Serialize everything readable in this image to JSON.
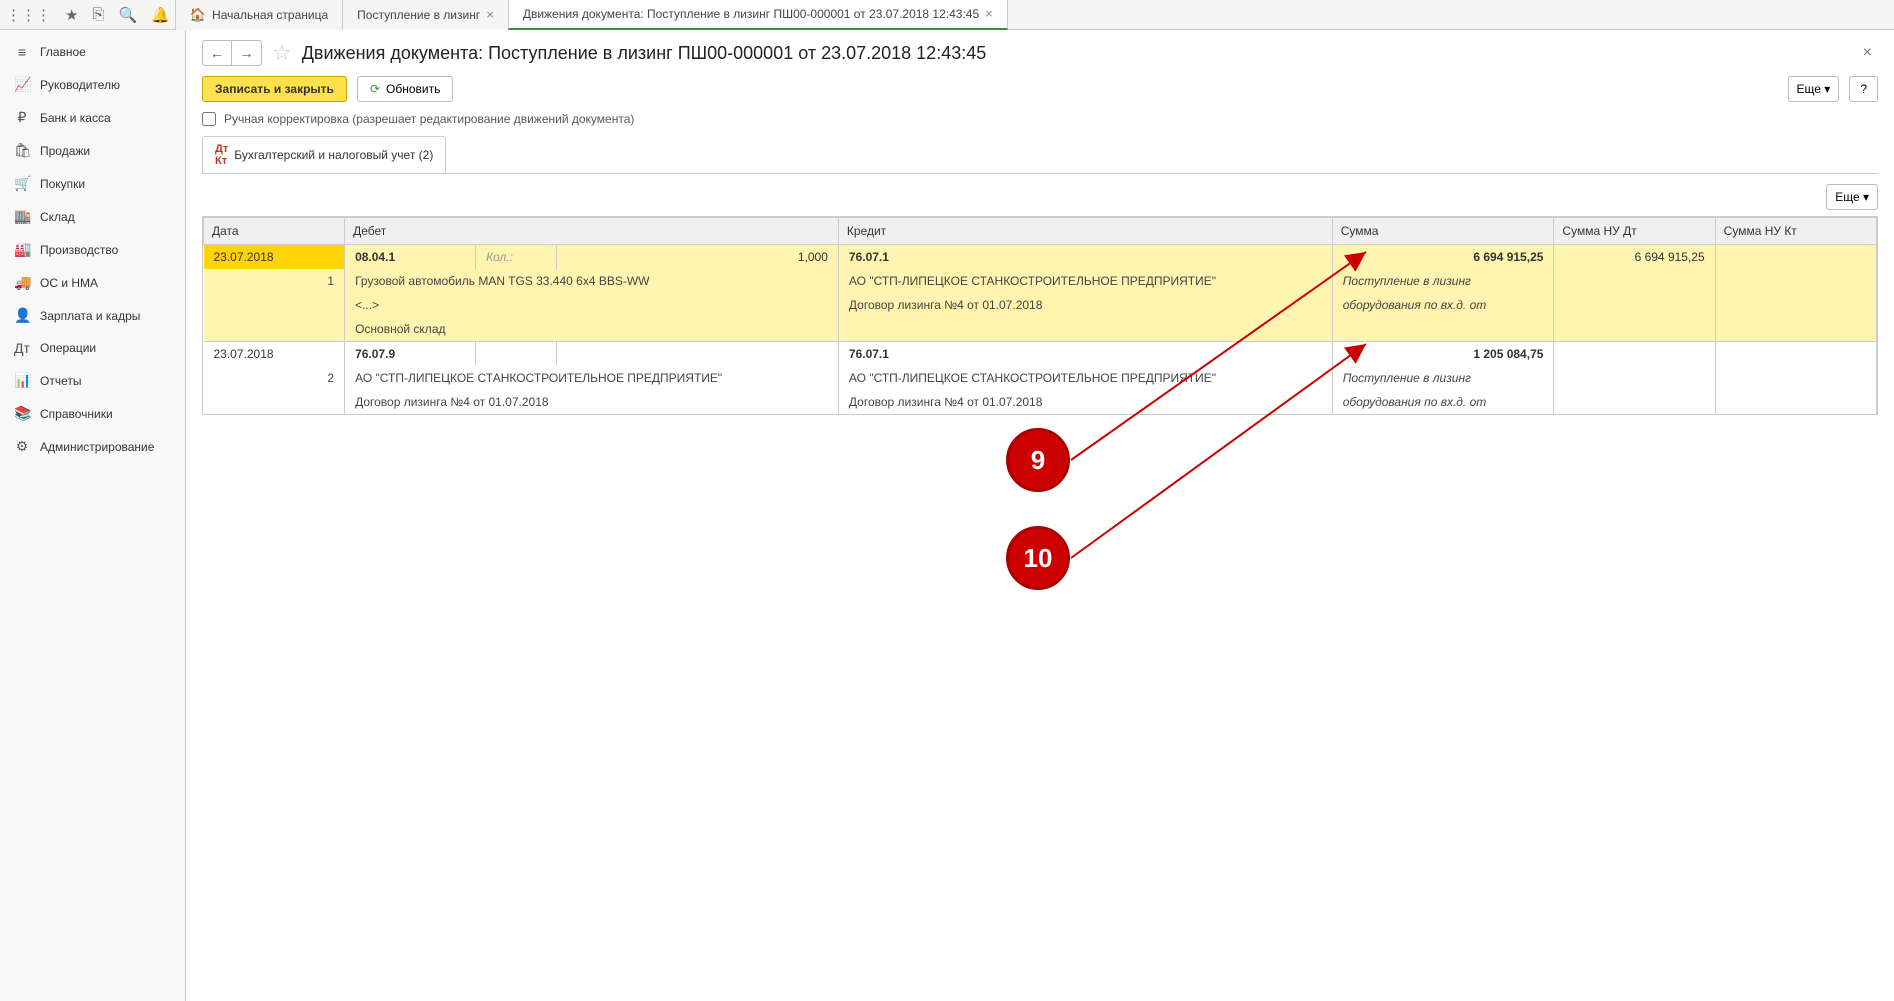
{
  "topTabs": {
    "home": "Начальная страница",
    "t1": "Поступление в лизинг",
    "t2": "Движения документа: Поступление в лизинг ПШ00-000001 от 23.07.2018 12:43:45"
  },
  "sidebar": [
    {
      "icon": "≡",
      "label": "Главное"
    },
    {
      "icon": "📈",
      "label": "Руководителю"
    },
    {
      "icon": "₽",
      "label": "Банк и касса"
    },
    {
      "icon": "🛍",
      "label": "Продажи"
    },
    {
      "icon": "🛒",
      "label": "Покупки"
    },
    {
      "icon": "🏬",
      "label": "Склад"
    },
    {
      "icon": "🏭",
      "label": "Производство"
    },
    {
      "icon": "🚚",
      "label": "ОС и НМА"
    },
    {
      "icon": "👤",
      "label": "Зарплата и кадры"
    },
    {
      "icon": "Дт",
      "label": "Операции"
    },
    {
      "icon": "📊",
      "label": "Отчеты"
    },
    {
      "icon": "📚",
      "label": "Справочники"
    },
    {
      "icon": "⚙",
      "label": "Администрирование"
    }
  ],
  "page": {
    "title": "Движения документа: Поступление в лизинг ПШ00-000001 от 23.07.2018 12:43:45",
    "saveClose": "Записать и закрыть",
    "refresh": "Обновить",
    "more": "Еще ▾",
    "help": "?",
    "manualLabel": "Ручная корректировка (разрешает редактирование движений документа)"
  },
  "innerTab": "Бухгалтерский и налоговый учет (2)",
  "cols": {
    "date": "Дата",
    "debit": "Дебет",
    "credit": "Кредит",
    "sum": "Сумма",
    "nudt": "Сумма НУ Дт",
    "nukt": "Сумма НУ Кт"
  },
  "rows": [
    {
      "n": "1",
      "date": "23.07.2018",
      "debAcc": "08.04.1",
      "kolLabel": "Кол.:",
      "kol": "1,000",
      "debL1": "Грузовой автомобиль MAN TGS 33.440 6x4 BBS-WW",
      "debL2": "<...>",
      "debL3": "Основной склад",
      "credAcc": "76.07.1",
      "credL1": "АО \"СТП-ЛИПЕЦКОЕ СТАНКОСТРОИТЕЛЬНОЕ ПРЕДПРИЯТИЕ\"",
      "credL2": "Договор лизинга №4 от 01.07.2018",
      "sum": "6 694 915,25",
      "nudt": "6 694 915,25",
      "nukt": "",
      "note1": "Поступление в лизинг",
      "note2": "оборудования по вх.д.   от"
    },
    {
      "n": "2",
      "date": "23.07.2018",
      "debAcc": "76.07.9",
      "kolLabel": "",
      "kol": "",
      "debL1": "АО \"СТП-ЛИПЕЦКОЕ СТАНКОСТРОИТЕЛЬНОЕ ПРЕДПРИЯТИЕ\"",
      "debL2": "Договор лизинга №4 от 01.07.2018",
      "debL3": "",
      "credAcc": "76.07.1",
      "credL1": "АО \"СТП-ЛИПЕЦКОЕ СТАНКОСТРОИТЕЛЬНОЕ ПРЕДПРИЯТИЕ\"",
      "credL2": "Договор лизинга №4 от 01.07.2018",
      "sum": "1 205 084,75",
      "nudt": "",
      "nukt": "",
      "note1": "Поступление в лизинг",
      "note2": "оборудования по вх.д.   от"
    }
  ],
  "annot": {
    "b1": "9",
    "b2": "10"
  }
}
